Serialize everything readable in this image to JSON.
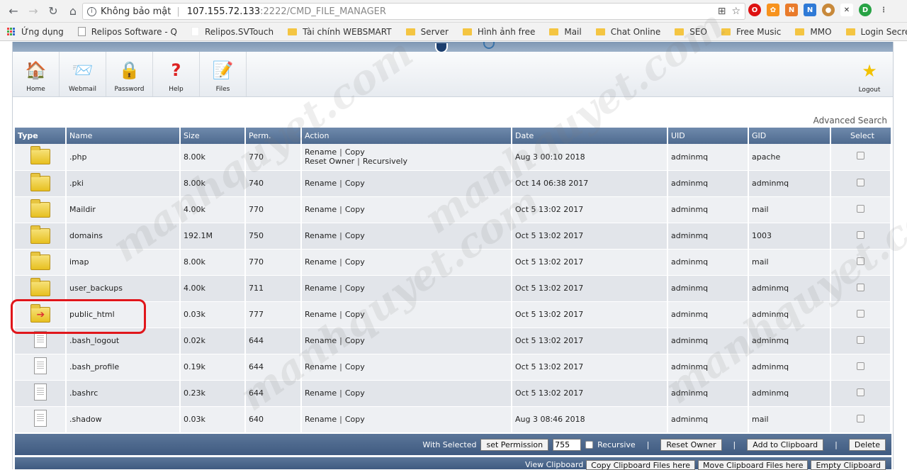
{
  "browser": {
    "security_label": "Không bảo mật",
    "url_host": "107.155.72.133",
    "url_path": ":2222/CMD_FILE_MANAGER"
  },
  "bookmarks": [
    "Ứng dụng",
    "Relipos Software - Q",
    "Relipos.SVTouch",
    "Tài chính WEBSMART",
    "Server",
    "Hình ảnh free",
    "Mail",
    "Chat Online",
    "SEO",
    "Free Music",
    "MMO",
    "Login Secret"
  ],
  "toolbar": {
    "home": "Home",
    "webmail": "Webmail",
    "password": "Password",
    "help": "Help",
    "files": "Files",
    "logout": "Logout"
  },
  "advanced_search": "Advanced Search",
  "columns": [
    "Type",
    "Name",
    "Size",
    "Perm.",
    "Action",
    "Date",
    "UID",
    "GID",
    "Select"
  ],
  "actions": {
    "rename": "Rename",
    "copy": "Copy",
    "reset_owner": "Reset Owner",
    "recursively": "Recursively"
  },
  "rows": [
    {
      "kind": "folder",
      "name": ".php",
      "size": "8.00k",
      "perm": "770",
      "date": "Aug 3 00:10 2018",
      "uid": "adminmq",
      "gid": "apache",
      "extra": true
    },
    {
      "kind": "folder",
      "name": ".pki",
      "size": "8.00k",
      "perm": "740",
      "date": "Oct 14 06:38 2017",
      "uid": "adminmq",
      "gid": "adminmq"
    },
    {
      "kind": "folder",
      "name": "Maildir",
      "size": "4.00k",
      "perm": "770",
      "date": "Oct 5 13:02 2017",
      "uid": "adminmq",
      "gid": "mail"
    },
    {
      "kind": "folder",
      "name": "domains",
      "size": "192.1M",
      "perm": "750",
      "date": "Oct 5 13:02 2017",
      "uid": "adminmq",
      "gid": "1003"
    },
    {
      "kind": "folder",
      "name": "imap",
      "size": "8.00k",
      "perm": "770",
      "date": "Oct 5 13:02 2017",
      "uid": "adminmq",
      "gid": "mail"
    },
    {
      "kind": "folder",
      "name": "user_backups",
      "size": "4.00k",
      "perm": "711",
      "date": "Oct 5 13:02 2017",
      "uid": "adminmq",
      "gid": "adminmq"
    },
    {
      "kind": "folder-pub",
      "name": "public_html",
      "size": "0.03k",
      "perm": "777",
      "date": "Oct 5 13:02 2017",
      "uid": "adminmq",
      "gid": "adminmq"
    },
    {
      "kind": "file",
      "name": ".bash_logout",
      "size": "0.02k",
      "perm": "644",
      "date": "Oct 5 13:02 2017",
      "uid": "adminmq",
      "gid": "adminmq"
    },
    {
      "kind": "file",
      "name": ".bash_profile",
      "size": "0.19k",
      "perm": "644",
      "date": "Oct 5 13:02 2017",
      "uid": "adminmq",
      "gid": "adminmq"
    },
    {
      "kind": "file",
      "name": ".bashrc",
      "size": "0.23k",
      "perm": "644",
      "date": "Oct 5 13:02 2017",
      "uid": "adminmq",
      "gid": "adminmq"
    },
    {
      "kind": "file",
      "name": ".shadow",
      "size": "0.03k",
      "perm": "640",
      "date": "Aug 3 08:46 2018",
      "uid": "adminmq",
      "gid": "mail"
    }
  ],
  "bottom": {
    "with_selected": "With Selected",
    "set_permission": "set Permission",
    "perm_value": "755",
    "recursive": "Recursive",
    "reset_owner": "Reset Owner",
    "add_clipboard": "Add to Clipboard",
    "delete": "Delete",
    "view_clipboard": "View Clipboard",
    "copy_clipboard": "Copy Clipboard Files here",
    "move_clipboard": "Move Clipboard Files here",
    "empty_clipboard": "Empty Clipboard"
  },
  "watermark": "manhquyet.com"
}
